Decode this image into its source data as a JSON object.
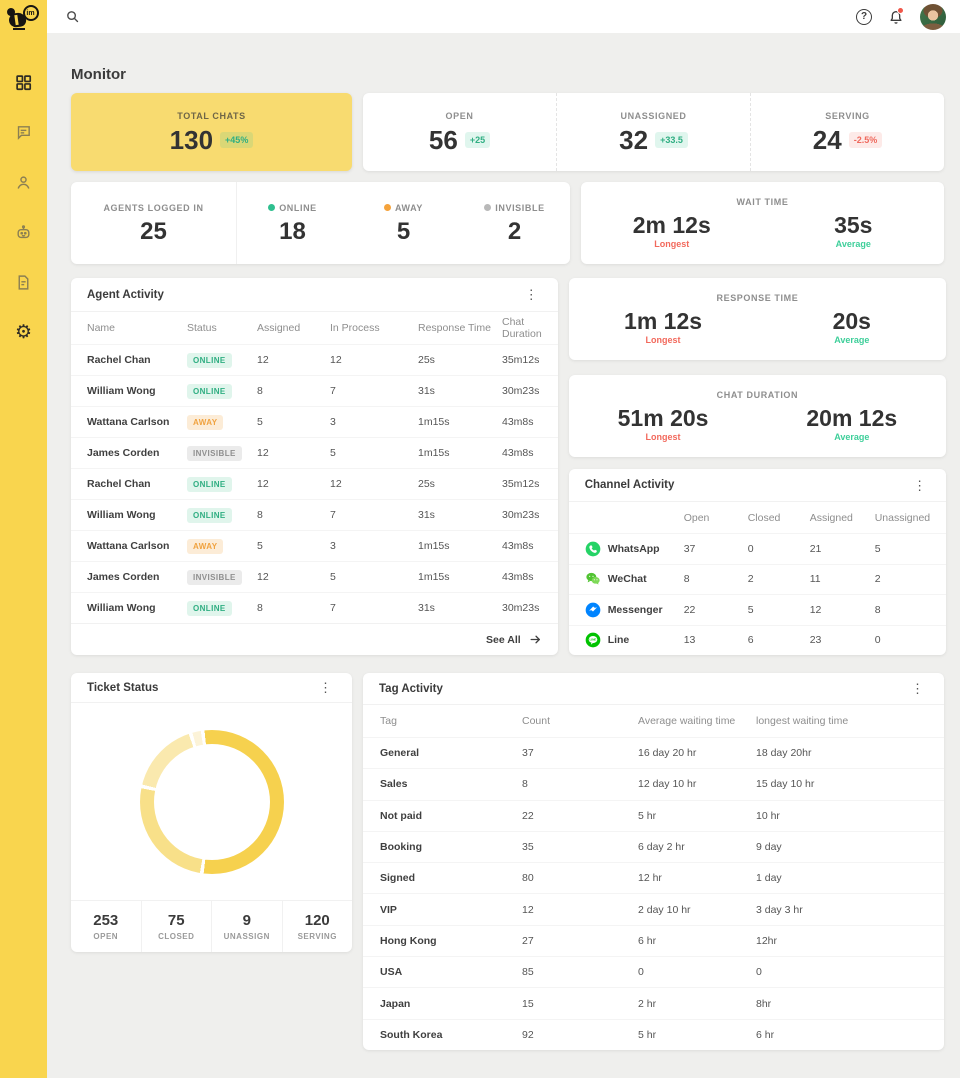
{
  "page_title": "Monitor",
  "sidebar": {
    "logo_text": "im",
    "items": [
      "dashboard",
      "chats",
      "contacts",
      "bot",
      "documents",
      "settings"
    ]
  },
  "stats": {
    "total_chats": {
      "label": "TOTAL CHATS",
      "value": "130",
      "delta": "+45%"
    },
    "open": {
      "label": "OPEN",
      "value": "56",
      "delta": "+25"
    },
    "unassigned": {
      "label": "UNASSIGNED",
      "value": "32",
      "delta": "+33.5"
    },
    "serving": {
      "label": "SERVING",
      "value": "24",
      "delta": "-2.5%"
    }
  },
  "agents": {
    "logged_in_label": "AGENTS LOGGED IN",
    "logged_in_value": "25",
    "statuses": [
      {
        "label": "ONLINE",
        "value": "18",
        "color": "#2fbf8f"
      },
      {
        "label": "AWAY",
        "value": "5",
        "color": "#f5a33c"
      },
      {
        "label": "INVISIBLE",
        "value": "2",
        "color": "#b9b9b9"
      }
    ]
  },
  "wait_time": {
    "title": "WAIT TIME",
    "longest": "2m 12s",
    "longest_label": "Longest",
    "average": "35s",
    "average_label": "Average"
  },
  "response_time": {
    "title": "RESPONSE TIME",
    "longest": "1m 12s",
    "longest_label": "Longest",
    "average": "20s",
    "average_label": "Average"
  },
  "chat_duration": {
    "title": "CHAT DURATION",
    "longest": "51m 20s",
    "longest_label": "Longest",
    "average": "20m 12s",
    "average_label": "Average"
  },
  "agent_activity": {
    "title": "Agent Activity",
    "columns": {
      "name": "Name",
      "status": "Status",
      "assigned": "Assigned",
      "in_process": "In Process",
      "response_time": "Response Time",
      "chat_duration": "Chat Duration"
    },
    "rows": [
      {
        "name": "Rachel Chan",
        "status": "ONLINE",
        "assigned": "12",
        "in_process": "12",
        "response_time": "25s",
        "chat_duration": "35m12s"
      },
      {
        "name": "William Wong",
        "status": "ONLINE",
        "assigned": "8",
        "in_process": "7",
        "response_time": "31s",
        "chat_duration": "30m23s"
      },
      {
        "name": "Wattana Carlson",
        "status": "AWAY",
        "assigned": "5",
        "in_process": "3",
        "response_time": "1m15s",
        "chat_duration": "43m8s"
      },
      {
        "name": "James Corden",
        "status": "INVISIBLE",
        "assigned": "12",
        "in_process": "5",
        "response_time": "1m15s",
        "chat_duration": "43m8s"
      },
      {
        "name": "Rachel Chan",
        "status": "ONLINE",
        "assigned": "12",
        "in_process": "12",
        "response_time": "25s",
        "chat_duration": "35m12s"
      },
      {
        "name": "William Wong",
        "status": "ONLINE",
        "assigned": "8",
        "in_process": "7",
        "response_time": "31s",
        "chat_duration": "30m23s"
      },
      {
        "name": "Wattana Carlson",
        "status": "AWAY",
        "assigned": "5",
        "in_process": "3",
        "response_time": "1m15s",
        "chat_duration": "43m8s"
      },
      {
        "name": "James Corden",
        "status": "INVISIBLE",
        "assigned": "12",
        "in_process": "5",
        "response_time": "1m15s",
        "chat_duration": "43m8s"
      },
      {
        "name": "William Wong",
        "status": "ONLINE",
        "assigned": "8",
        "in_process": "7",
        "response_time": "31s",
        "chat_duration": "30m23s"
      }
    ],
    "see_all_label": "See All"
  },
  "channel_activity": {
    "title": "Channel Activity",
    "columns": {
      "open": "Open",
      "closed": "Closed",
      "assigned": "Assigned",
      "unassigned": "Unassigned"
    },
    "rows": [
      {
        "name": "WhatsApp",
        "icon": "whatsapp-icon",
        "color": "#25D366",
        "open": "37",
        "closed": "0",
        "assigned": "21",
        "unassigned": "5"
      },
      {
        "name": "WeChat",
        "icon": "wechat-icon",
        "color": "#51C332",
        "open": "8",
        "closed": "2",
        "assigned": "11",
        "unassigned": "2"
      },
      {
        "name": "Messenger",
        "icon": "messenger-icon",
        "color": "#0084FF",
        "open": "22",
        "closed": "5",
        "assigned": "12",
        "unassigned": "8"
      },
      {
        "name": "Line",
        "icon": "line-icon",
        "color": "#00C300",
        "open": "13",
        "closed": "6",
        "assigned": "23",
        "unassigned": "0"
      }
    ]
  },
  "ticket_status": {
    "title": "Ticket Status",
    "chart_data": {
      "type": "pie",
      "labels": [
        "Open",
        "Serving",
        "Closed",
        "Unassign"
      ],
      "values": [
        253,
        120,
        75,
        9
      ],
      "colors": [
        "#F6D14E",
        "#F8E089",
        "#FAE9AE",
        "#FCF3D8"
      ],
      "title": "Ticket Status",
      "legend_position": "none"
    },
    "stats": [
      {
        "value": "253",
        "label": "OPEN"
      },
      {
        "value": "75",
        "label": "CLOSED"
      },
      {
        "value": "9",
        "label": "UNASSIGN"
      },
      {
        "value": "120",
        "label": "SERVING"
      }
    ]
  },
  "tag_activity": {
    "title": "Tag Activity",
    "columns": {
      "tag": "Tag",
      "count": "Count",
      "avg": "Average waiting time",
      "longest": "longest waiting time"
    },
    "rows": [
      {
        "tag": "General",
        "count": "37",
        "avg": "16 day 20 hr",
        "longest": "18 day 20hr"
      },
      {
        "tag": "Sales",
        "count": "8",
        "avg": "12 day 10 hr",
        "longest": "15 day 10 hr"
      },
      {
        "tag": "Not paid",
        "count": "22",
        "avg": "5 hr",
        "longest": "10 hr"
      },
      {
        "tag": "Booking",
        "count": "35",
        "avg": "6 day 2 hr",
        "longest": "9 day"
      },
      {
        "tag": "Signed",
        "count": "80",
        "avg": "12 hr",
        "longest": "1 day"
      },
      {
        "tag": "VIP",
        "count": "12",
        "avg": "2 day 10 hr",
        "longest": "3 day 3 hr"
      },
      {
        "tag": "Hong Kong",
        "count": "27",
        "avg": "6 hr",
        "longest": "12hr"
      },
      {
        "tag": "USA",
        "count": "85",
        "avg": "0",
        "longest": "0"
      },
      {
        "tag": "Japan",
        "count": "15",
        "avg": "2 hr",
        "longest": "8hr"
      },
      {
        "tag": "South Korea",
        "count": "92",
        "avg": "5 hr",
        "longest": "6 hr"
      }
    ]
  }
}
